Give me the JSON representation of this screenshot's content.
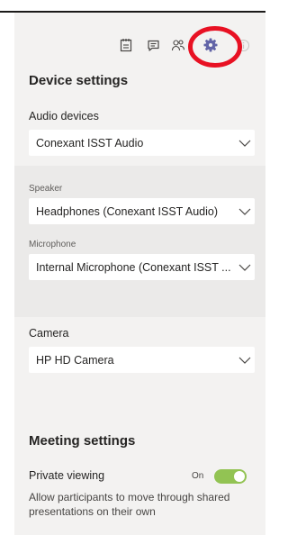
{
  "toolbar": {
    "icons": [
      "notes-icon",
      "chat-icon",
      "participants-icon",
      "settings-gear-icon",
      "info-icon"
    ]
  },
  "device_settings": {
    "title": "Device settings",
    "audio": {
      "label": "Audio devices",
      "value": "Conexant ISST Audio"
    },
    "speaker": {
      "label": "Speaker",
      "value": "Headphones (Conexant ISST Audio)"
    },
    "microphone": {
      "label": "Microphone",
      "value": "Internal Microphone (Conexant ISST ..."
    },
    "camera": {
      "label": "Camera",
      "value": "HP HD Camera"
    }
  },
  "meeting_settings": {
    "title": "Meeting settings",
    "private_viewing": {
      "label": "Private viewing",
      "state_label": "On",
      "enabled": true,
      "description": "Allow participants to move through shared presentations on their own"
    }
  },
  "colors": {
    "accent_toggle": "#92c353",
    "annotation_circle": "#e81123",
    "gear_icon": "#6264a7"
  }
}
